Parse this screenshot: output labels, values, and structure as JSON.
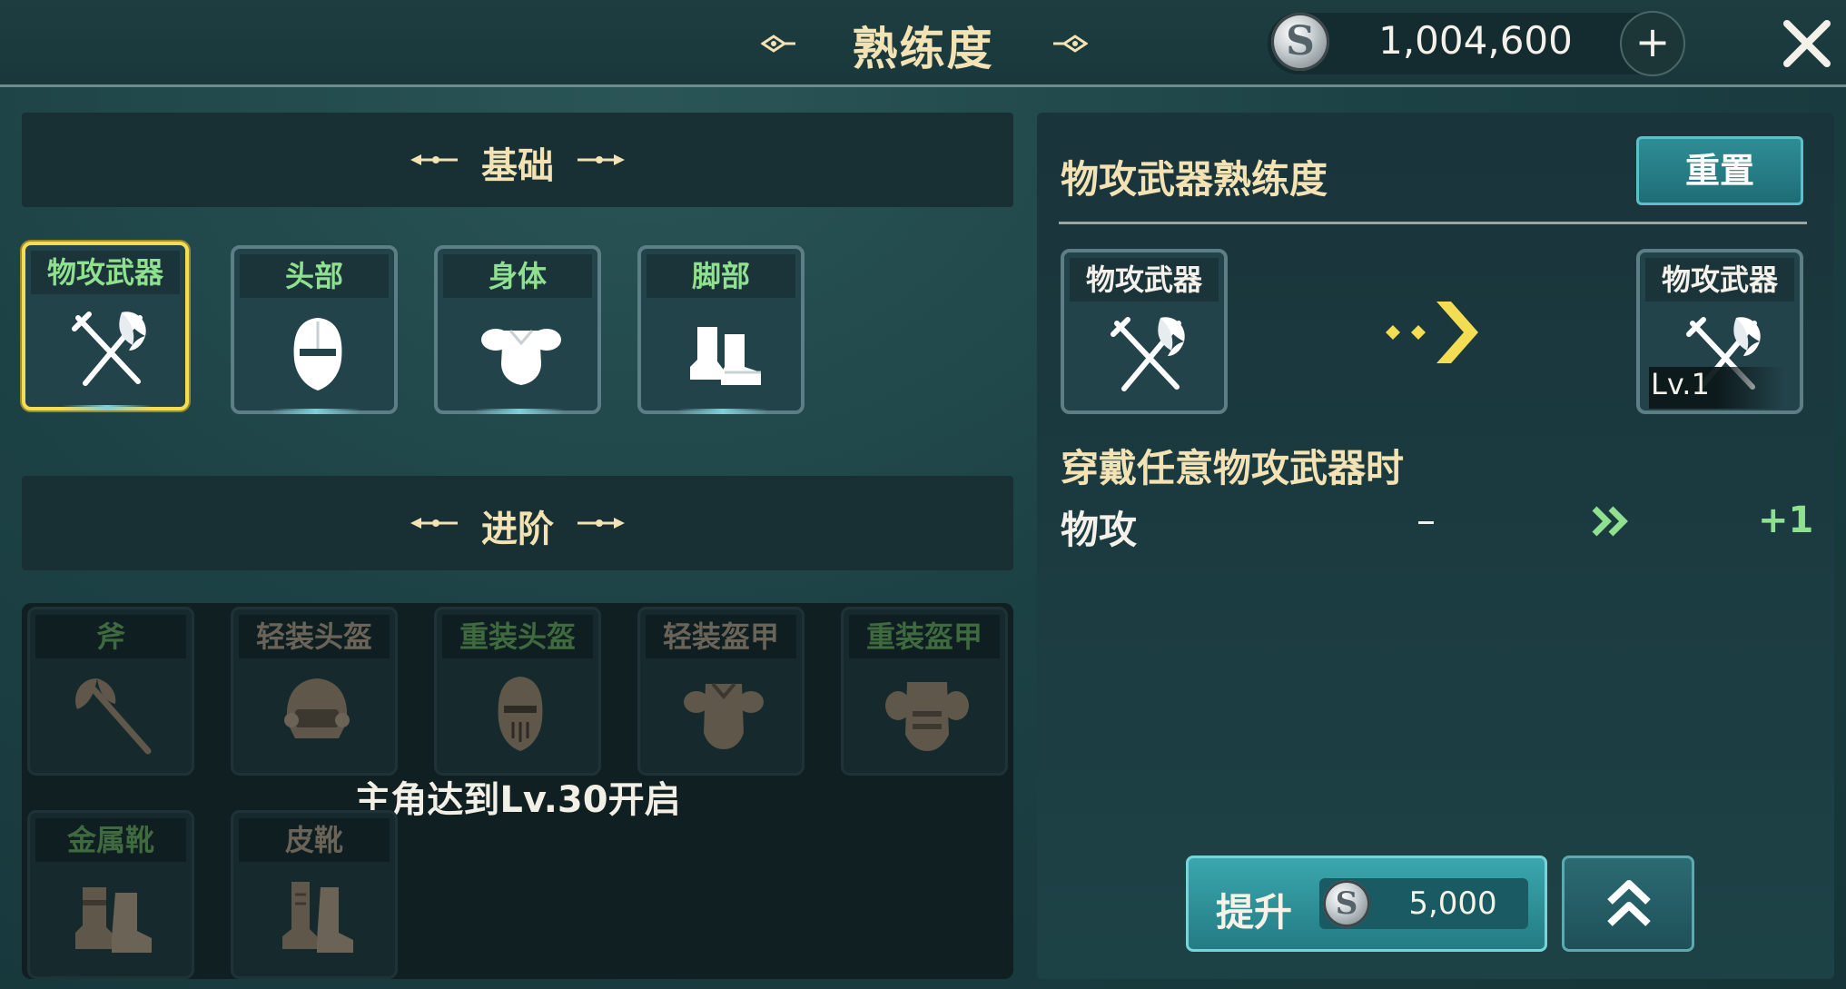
{
  "header": {
    "title": "熟练度",
    "currency_value": "1,004,600",
    "coin_glyph": "S",
    "add_label": "+"
  },
  "basic_section": {
    "title": "基础",
    "slots": [
      {
        "label": "物攻武器",
        "icon": "crossed-sword-axe-icon",
        "selected": true
      },
      {
        "label": "头部",
        "icon": "helmet-icon"
      },
      {
        "label": "身体",
        "icon": "body-armor-icon"
      },
      {
        "label": "脚部",
        "icon": "boots-icon"
      }
    ]
  },
  "advanced_section": {
    "title": "进阶",
    "lock_text": "主角达到Lv.30开启",
    "slots": [
      {
        "label": "斧",
        "icon": "axe-icon",
        "label_color": "#3f6a3f"
      },
      {
        "label": "轻装头盔",
        "icon": "light-helmet-icon",
        "label_color": "#6a6458"
      },
      {
        "label": "重装头盔",
        "icon": "heavy-helmet-icon",
        "label_color": "#3f6a3f"
      },
      {
        "label": "轻装盔甲",
        "icon": "light-armor-icon",
        "label_color": "#6a6458"
      },
      {
        "label": "重装盔甲",
        "icon": "heavy-armor-icon",
        "label_color": "#3f6a3f"
      },
      {
        "label": "金属靴",
        "icon": "metal-boots-icon",
        "label_color": "#3f6a3f"
      },
      {
        "label": "皮靴",
        "icon": "leather-boots-icon",
        "label_color": "#6a6458"
      }
    ]
  },
  "detail": {
    "title": "物攻武器熟练度",
    "reset_label": "重置",
    "current_slot_label": "物攻武器",
    "next_slot_label": "物攻武器",
    "next_level": "Lv.1",
    "condition": "穿戴任意物攻武器时",
    "stat_name": "物攻",
    "stat_current": "–",
    "stat_next": "+1",
    "upgrade_label": "提升",
    "upgrade_cost": "5,000"
  },
  "colors": {
    "gold_text": "#f2e2b4",
    "green_text": "#8fe08f",
    "selected_border": "#f3dd52",
    "button_teal": "#2e8d95"
  }
}
